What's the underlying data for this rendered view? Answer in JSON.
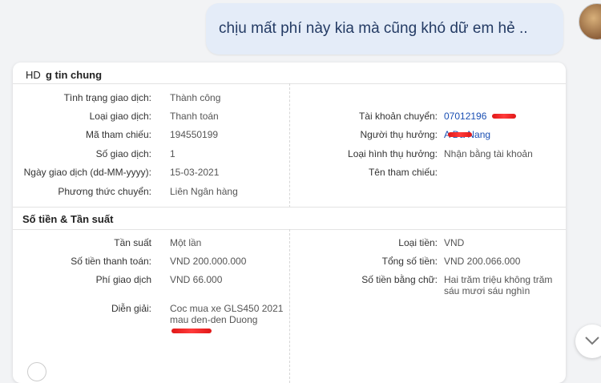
{
  "chat": {
    "message": "chịu mất phí này kia mà cũng khó dữ em hẻ .."
  },
  "card": {
    "badge": "HD",
    "section1_title": "g tin chung",
    "left_rows": [
      {
        "label": "Tình trạng giao dịch:",
        "value": "Thành công"
      },
      {
        "label": "Loại giao dịch:",
        "value": "Thanh toán"
      },
      {
        "label": "Mã tham chiếu:",
        "value": "194550199"
      },
      {
        "label": "Số giao dịch:",
        "value": "1"
      },
      {
        "label": "Ngày giao dịch (dd-MM-yyyy):",
        "value": "15-03-2021"
      },
      {
        "label": "Phương thức chuyển:",
        "value": "Liên Ngân hàng"
      }
    ],
    "right_rows": [
      {
        "label": "Tài khoản chuyển:",
        "value": "07012196"
      },
      {
        "label": "Người thụ hưởng:",
        "value": "A Da Nang"
      },
      {
        "label": "Loại hình thụ hưởng:",
        "value": "Nhận bằng tài khoản"
      },
      {
        "label": "Tên tham chiếu:",
        "value": ""
      }
    ],
    "section2_title": "Số tiền & Tần suất",
    "left2_rows": [
      {
        "label": "Tần suất",
        "value": "Một lần"
      },
      {
        "label": "Số tiền thanh toán:",
        "value": "VND 200.000.000"
      },
      {
        "label": "Phí giao dịch",
        "value": "VND 66.000"
      },
      {
        "label": "Diễn giải:",
        "value": "Coc mua xe GLS450 2021 mau den-den Duong"
      }
    ],
    "right2_rows": [
      {
        "label": "Loại tiền:",
        "value": "VND"
      },
      {
        "label": "Tổng số tiền:",
        "value": "VND 200.066.000"
      },
      {
        "label": "Số tiền bằng chữ:",
        "value": "Hai trăm triệu không trăm sáu mươi sáu nghìn"
      }
    ]
  },
  "colors": {
    "bubble": "#e4ecf8",
    "link": "#1a4fb3",
    "redaction": "#e01818"
  },
  "icons": {
    "scroll": "chevron-down-icon",
    "avatar": "avatar"
  }
}
